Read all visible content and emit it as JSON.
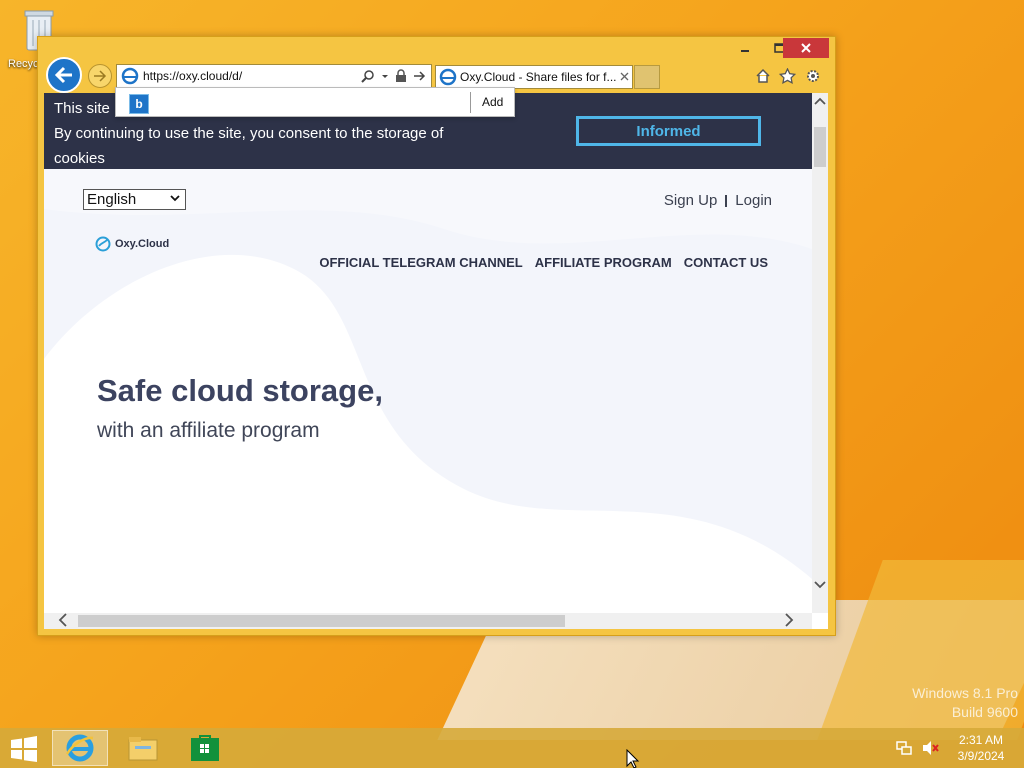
{
  "desktop": {
    "recycle_bin_label": "Recyc",
    "watermark_line1": "Windows 8.1 Pro",
    "watermark_line2": "Build 9600"
  },
  "browser": {
    "address": "https://oxy.cloud/d/",
    "tab_title": "Oxy.Cloud - Share files for f...",
    "address_suggest": {
      "add_label": "Add"
    }
  },
  "cookie_banner": {
    "line1": "This site",
    "line2": "By continuing to use the site, you consent to the storage of",
    "line3": "cookies",
    "button": "Informed"
  },
  "site": {
    "language": "English",
    "signup": "Sign Up",
    "login": "Login",
    "logo_text": "Oxy.Cloud",
    "menu": [
      "OFFICIAL TELEGRAM CHANNEL",
      "AFFILIATE PROGRAM",
      "CONTACT US"
    ],
    "headline": "Safe cloud storage,",
    "subheadline": "with an affiliate program"
  },
  "taskbar": {
    "time": "2:31 AM",
    "date": "3/9/2024"
  },
  "colors": {
    "banner_bg": "#2d3248",
    "informed_accent": "#4fb6e8",
    "ie_blue": "#1e74c8"
  }
}
